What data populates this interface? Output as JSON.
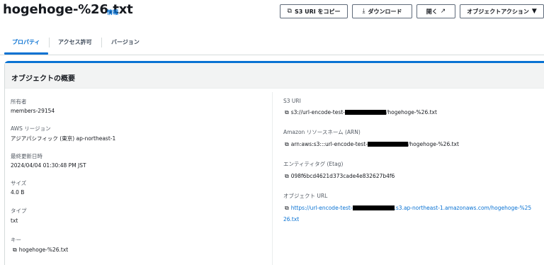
{
  "header": {
    "title": "hogehoge-%26.txt",
    "info_label": "情報",
    "buttons": {
      "copy_s3_uri": "S3 URI をコピー",
      "download": "ダウンロード",
      "open": "開く",
      "object_actions": "オブジェクトアクション"
    }
  },
  "tabs": [
    {
      "label": "プロパティ",
      "active": true
    },
    {
      "label": "アクセス許可",
      "active": false
    },
    {
      "label": "バージョン",
      "active": false
    }
  ],
  "panel": {
    "title": "オブジェクトの概要"
  },
  "left": {
    "owner": {
      "label": "所有者",
      "value": "members-29154"
    },
    "region": {
      "label": "AWS リージョン",
      "value": "アジアパシフィック (東京) ap-northeast-1"
    },
    "modified": {
      "label": "最終更新日時",
      "value": "2024/04/04 01:30:48 PM JST"
    },
    "size": {
      "label": "サイズ",
      "value": "4.0 B"
    },
    "type": {
      "label": "タイプ",
      "value": "txt"
    },
    "key": {
      "label": "キー",
      "value": "hogehoge-%26.txt"
    }
  },
  "right": {
    "s3_uri": {
      "label": "S3 URI",
      "prefix": "s3://url-encode-test-",
      "suffix": "/hogehoge-%26.txt"
    },
    "arn": {
      "label": "Amazon リソースネーム (ARN)",
      "prefix": "arn:aws:s3:::url-encode-test-",
      "suffix": "/hogehoge-%26.txt"
    },
    "etag": {
      "label": "エンティティタグ (Etag)",
      "value": "098f6bcd4621d373cade4e832627b4f6"
    },
    "object_url": {
      "label": "オブジェクト URL",
      "prefix": "https://url-encode-test-",
      "suffix": ".s3.ap-northeast-1.amazonaws.com/hogehoge-%25",
      "line2": "26.txt"
    }
  },
  "icons": {
    "copy": "copy-icon",
    "download": "download-icon",
    "external": "external-link-icon",
    "dropdown": "caret-down-icon"
  },
  "colors": {
    "accent": "#0972d3",
    "text": "#16191f",
    "muted": "#545b64",
    "header_bg": "#f2f3f3"
  }
}
